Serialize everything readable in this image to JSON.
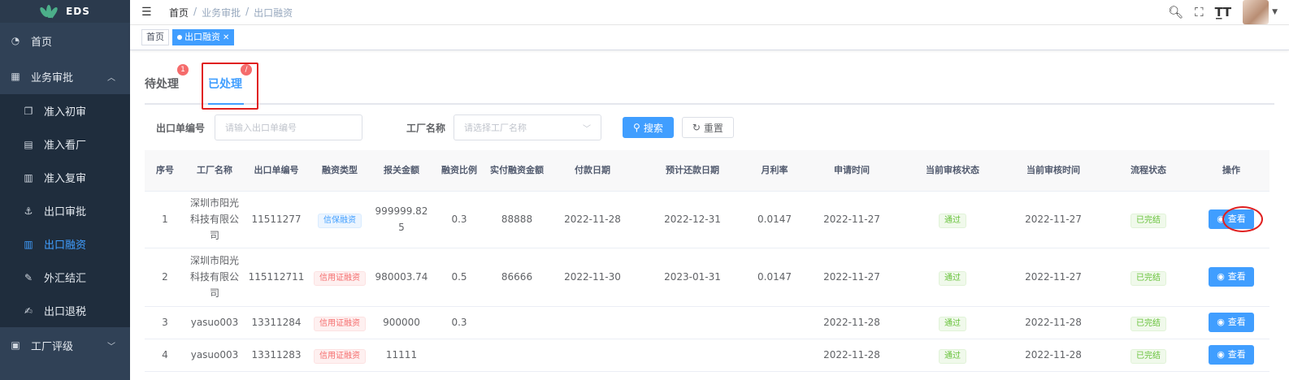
{
  "app": {
    "logo_text": "EDS"
  },
  "sidebar": {
    "items": [
      {
        "label": "首页",
        "icon": "dashboard-icon"
      },
      {
        "label": "业务审批",
        "icon": "grid-icon",
        "expanded": true
      }
    ],
    "sub_items": [
      {
        "label": "准入初审",
        "icon": "document-icon"
      },
      {
        "label": "准入看厂",
        "icon": "calendar-icon"
      },
      {
        "label": "准入复审",
        "icon": "book-icon"
      },
      {
        "label": "出口审批",
        "icon": "anchor-icon"
      },
      {
        "label": "出口融资",
        "icon": "columns-icon",
        "active": true
      },
      {
        "label": "外汇结汇",
        "icon": "edit-icon"
      },
      {
        "label": "出口退税",
        "icon": "edit-doc-icon"
      }
    ],
    "bottom_item": {
      "label": "工厂评级",
      "icon": "chart-icon"
    }
  },
  "breadcrumb": [
    "首页",
    "业务审批",
    "出口融资"
  ],
  "tags": [
    {
      "label": "首页"
    },
    {
      "label": "出口融资",
      "active": true
    }
  ],
  "tabs": [
    {
      "label": "待处理",
      "badge": "1"
    },
    {
      "label": "已处理",
      "badge": "/",
      "active": true
    }
  ],
  "search": {
    "order_label": "出口单编号",
    "order_placeholder": "请输入出口单编号",
    "factory_label": "工厂名称",
    "factory_placeholder": "请选择工厂名称",
    "search_btn": "搜索",
    "reset_btn": "重置"
  },
  "table": {
    "headers": [
      "序号",
      "工厂名称",
      "出口单编号",
      "融资类型",
      "报关金额",
      "融资比例",
      "实付融资金额",
      "付款日期",
      "预计还款日期",
      "月利率",
      "申请时间",
      "当前审核状态",
      "当前审核时间",
      "流程状态",
      "操作"
    ],
    "rows": [
      {
        "no": "1",
        "factory": "深圳市阳光科技有限公司",
        "order": "11511277",
        "type": "信保融资",
        "type_style": "info",
        "amount": "999999.825",
        "ratio": "0.3",
        "paid": "88888",
        "pay_date": "2022-11-28",
        "repay_date": "2022-12-31",
        "rate": "0.0147",
        "apply": "2022-11-27",
        "status": "通过",
        "audit_time": "2022-11-27",
        "flow": "已完结",
        "action": "查看"
      },
      {
        "no": "2",
        "factory": "深圳市阳光科技有限公司",
        "order": "115112711",
        "type": "信用证融资",
        "type_style": "danger",
        "amount": "980003.74",
        "ratio": "0.5",
        "paid": "86666",
        "pay_date": "2022-11-30",
        "repay_date": "2023-01-31",
        "rate": "0.0147",
        "apply": "2022-11-27",
        "status": "通过",
        "audit_time": "2022-11-27",
        "flow": "已完结",
        "action": "查看"
      },
      {
        "no": "3",
        "factory": "yasuo003",
        "order": "13311284",
        "type": "信用证融资",
        "type_style": "danger",
        "amount": "900000",
        "ratio": "0.3",
        "paid": "",
        "pay_date": "",
        "repay_date": "",
        "rate": "",
        "apply": "2022-11-28",
        "status": "通过",
        "audit_time": "2022-11-28",
        "flow": "已完结",
        "action": "查看"
      },
      {
        "no": "4",
        "factory": "yasuo003",
        "order": "13311283",
        "type": "信用证融资",
        "type_style": "danger",
        "amount": "11111",
        "ratio": "",
        "paid": "",
        "pay_date": "",
        "repay_date": "",
        "rate": "",
        "apply": "2022-11-28",
        "status": "通过",
        "audit_time": "2022-11-28",
        "flow": "已完结",
        "action": "查看"
      }
    ]
  }
}
